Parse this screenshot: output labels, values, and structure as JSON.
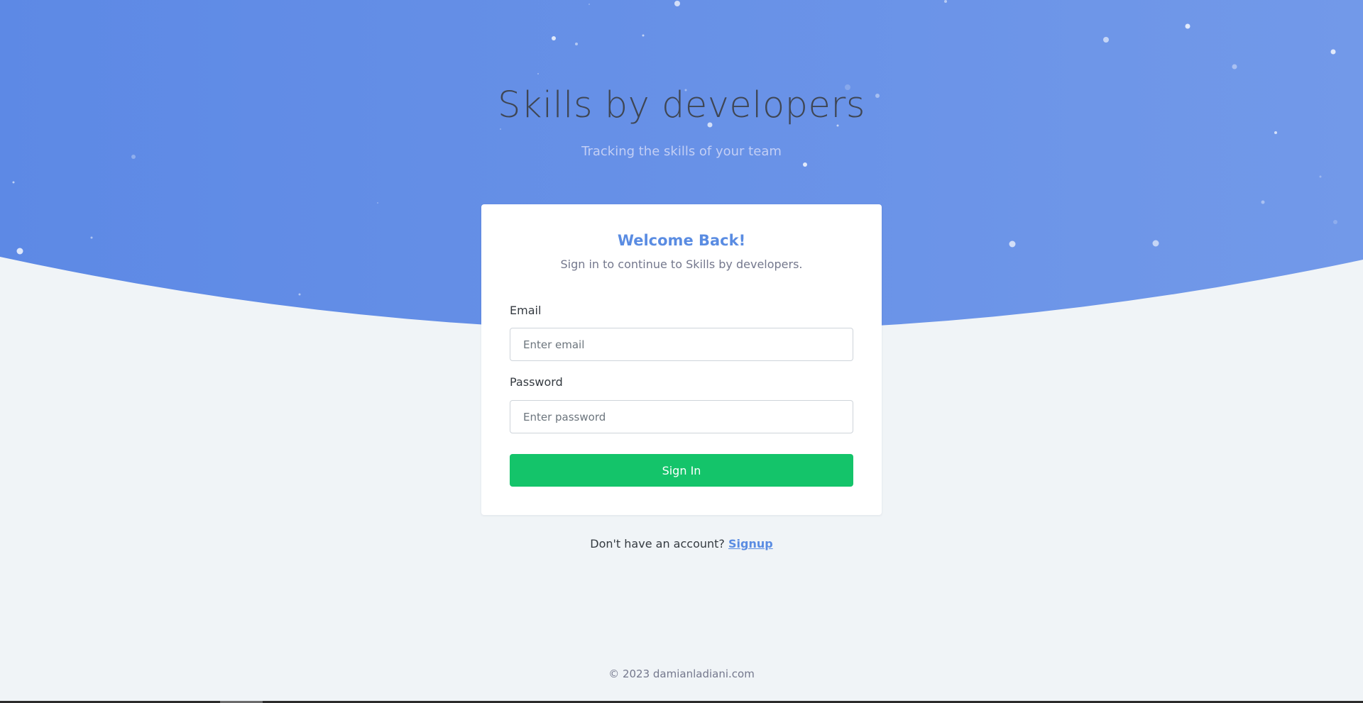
{
  "hero": {
    "title": "Skills by developers",
    "subtitle": "Tracking the skills of your team"
  },
  "login": {
    "title": "Welcome Back!",
    "subtitle": "Sign in to continue to Skills by developers.",
    "email": {
      "label": "Email",
      "placeholder": "Enter email",
      "value": ""
    },
    "password": {
      "label": "Password",
      "placeholder": "Enter password",
      "value": ""
    },
    "submit_label": "Sign In"
  },
  "signup": {
    "prompt": "Don't have an account?",
    "link_label": "Signup"
  },
  "footer": {
    "text": "© 2023 damianladiani.com"
  },
  "colors": {
    "hero_start": "#5d89e5",
    "hero_end": "#7299e9",
    "page_background": "#f0f4f7",
    "accent": "#5a8ce2",
    "primary_button": "#14c46a"
  }
}
